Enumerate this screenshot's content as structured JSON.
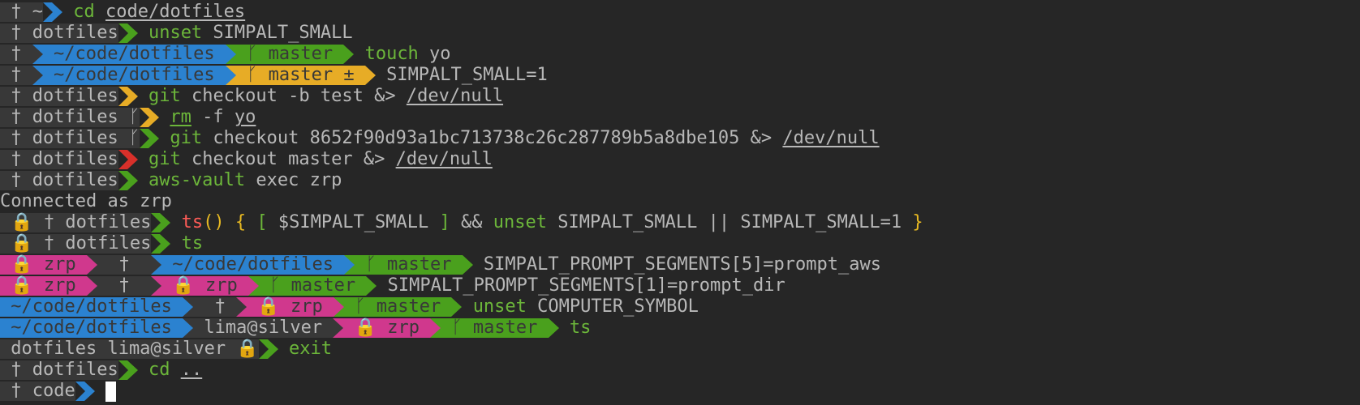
{
  "colors": {
    "bg": "#262626",
    "blue": "#2b82d0",
    "green": "#4aa01d",
    "yellow": "#e7ac26",
    "red": "#d8302a",
    "magenta": "#d0388d",
    "dark": "#383838",
    "text": "#b8b8b8",
    "cmd_green": "#6cb63a",
    "cmd_red": "#ff5c57",
    "cmd_yellow": "#e6b822",
    "cmd_blue": "#3c8bd1"
  },
  "lines": [
    {
      "segs": [
        {
          "t": " † ~",
          "bg": "dark",
          "fg": "text"
        },
        {
          "t": " ",
          "bg": "blue",
          "fg": "dark",
          "arrowOnly": true
        }
      ],
      "cmd": [
        {
          "t": " "
        },
        {
          "t": "cd",
          "c": "cmd_green"
        },
        {
          "t": " "
        },
        {
          "t": "code/dotfiles",
          "u": true
        }
      ]
    },
    {
      "segs": [
        {
          "t": " † dotfiles",
          "bg": "dark",
          "fg": "text"
        },
        {
          "t": "",
          "bg": "green",
          "arrowOnly": true
        }
      ],
      "cmd": [
        {
          "t": " "
        },
        {
          "t": "unset",
          "c": "cmd_green"
        },
        {
          "t": " SIMPALT_SMALL"
        }
      ]
    },
    {
      "segs": [
        {
          "t": " † ",
          "bg": "dark",
          "fg": "text"
        },
        {
          "t": " ~/code/dotfiles ",
          "bg": "blue",
          "fg": "dark"
        },
        {
          "t": " ᚴ master ",
          "bg": "green",
          "fg": "dark"
        }
      ],
      "cmd": [
        {
          "t": " "
        },
        {
          "t": "touch",
          "c": "cmd_green"
        },
        {
          "t": " yo"
        }
      ]
    },
    {
      "segs": [
        {
          "t": " † ",
          "bg": "dark",
          "fg": "text"
        },
        {
          "t": " ~/code/dotfiles ",
          "bg": "blue",
          "fg": "dark"
        },
        {
          "t": " ᚴ master ± ",
          "bg": "yellow",
          "fg": "dark"
        }
      ],
      "cmd": [
        {
          "t": " SIMPALT_SMALL=1"
        }
      ]
    },
    {
      "segs": [
        {
          "t": " † dotfiles",
          "bg": "dark",
          "fg": "text"
        },
        {
          "t": "",
          "bg": "yellow",
          "arrowOnly": true
        }
      ],
      "cmd": [
        {
          "t": " "
        },
        {
          "t": "git",
          "c": "cmd_green"
        },
        {
          "t": " checkout -b test &> "
        },
        {
          "t": "/dev/null",
          "u": true
        }
      ]
    },
    {
      "segs": [
        {
          "t": " † dotfiles ",
          "bg": "dark",
          "fg": "text"
        },
        {
          "t": "ᚴ",
          "bg": "dark",
          "fg": "text",
          "branch": true
        },
        {
          "t": "",
          "bg": "yellow",
          "arrowOnly": true
        }
      ],
      "cmd": [
        {
          "t": " "
        },
        {
          "t": "rm",
          "c": "cmd_green",
          "u": true
        },
        {
          "t": " -f "
        },
        {
          "t": "yo",
          "u": true
        }
      ]
    },
    {
      "segs": [
        {
          "t": " † dotfiles ",
          "bg": "dark",
          "fg": "text"
        },
        {
          "t": "ᚴ",
          "bg": "dark",
          "fg": "text",
          "branch": true
        },
        {
          "t": "",
          "bg": "green",
          "arrowOnly": true
        }
      ],
      "cmd": [
        {
          "t": " "
        },
        {
          "t": "git",
          "c": "cmd_green"
        },
        {
          "t": " checkout 8652f90d93a1bc713738c26c287789b5a8dbe105 &> "
        },
        {
          "t": "/dev/null",
          "u": true
        }
      ]
    },
    {
      "segs": [
        {
          "t": " † dotfiles",
          "bg": "dark",
          "fg": "text"
        },
        {
          "t": "",
          "bg": "red",
          "arrowOnly": true
        }
      ],
      "cmd": [
        {
          "t": " "
        },
        {
          "t": "git",
          "c": "cmd_green"
        },
        {
          "t": " checkout master &> "
        },
        {
          "t": "/dev/null",
          "u": true
        }
      ]
    },
    {
      "segs": [
        {
          "t": " † dotfiles",
          "bg": "dark",
          "fg": "text"
        },
        {
          "t": "",
          "bg": "green",
          "arrowOnly": true
        }
      ],
      "cmd": [
        {
          "t": " "
        },
        {
          "t": "aws-vault",
          "c": "cmd_green"
        },
        {
          "t": " exec zrp"
        }
      ]
    },
    {
      "plain": "Connected as zrp"
    },
    {
      "segs": [
        {
          "t": " 🔒 † dotfiles",
          "bg": "dark",
          "fg": "text",
          "lock": true
        },
        {
          "t": "",
          "bg": "green",
          "arrowOnly": true
        }
      ],
      "cmd": [
        {
          "t": " "
        },
        {
          "t": "ts",
          "c": "cmd_red"
        },
        {
          "t": "()",
          "c": "cmd_yellow"
        },
        {
          "t": " "
        },
        {
          "t": "{",
          "c": "cmd_yellow"
        },
        {
          "t": " "
        },
        {
          "t": "[",
          "c": "cmd_green"
        },
        {
          "t": " $SIMPALT_SMALL "
        },
        {
          "t": "]",
          "c": "cmd_green"
        },
        {
          "t": " && "
        },
        {
          "t": "unset",
          "c": "cmd_green"
        },
        {
          "t": " SIMPALT_SMALL || SIMPALT_SMALL=1 "
        },
        {
          "t": "}",
          "c": "cmd_yellow"
        }
      ]
    },
    {
      "segs": [
        {
          "t": " 🔒 † dotfiles",
          "bg": "dark",
          "fg": "text",
          "lock": true
        },
        {
          "t": "",
          "bg": "green",
          "arrowOnly": true
        }
      ],
      "cmd": [
        {
          "t": " "
        },
        {
          "t": "ts",
          "c": "cmd_green"
        }
      ]
    },
    {
      "segs": [
        {
          "t": " 🔒 zrp ",
          "bg": "magenta",
          "fg": "dark",
          "lock": true
        },
        {
          "t": "  †  ",
          "bg": "dark",
          "fg": "text"
        },
        {
          "t": " ~/code/dotfiles ",
          "bg": "blue",
          "fg": "dark"
        },
        {
          "t": " ᚴ master ",
          "bg": "green",
          "fg": "dark"
        }
      ],
      "cmd": [
        {
          "t": " SIMPALT_PROMPT_SEGMENTS[5]=prompt_aws"
        }
      ]
    },
    {
      "segs": [
        {
          "t": " 🔒 zrp ",
          "bg": "magenta",
          "fg": "dark",
          "lock": true
        },
        {
          "t": "  †  ",
          "bg": "dark",
          "fg": "text"
        },
        {
          "t": " 🔒 zrp ",
          "bg": "magenta",
          "fg": "dark",
          "lock": true
        },
        {
          "t": " ᚴ master ",
          "bg": "green",
          "fg": "dark"
        }
      ],
      "cmd": [
        {
          "t": " SIMPALT_PROMPT_SEGMENTS[1]=prompt_dir"
        }
      ]
    },
    {
      "segs": [
        {
          "t": " ~/code/dotfiles ",
          "bg": "blue",
          "fg": "dark"
        },
        {
          "t": "  † ",
          "bg": "dark",
          "fg": "text"
        },
        {
          "t": " 🔒 zrp ",
          "bg": "magenta",
          "fg": "dark",
          "lock": true
        },
        {
          "t": " ᚴ master ",
          "bg": "green",
          "fg": "dark"
        }
      ],
      "cmd": [
        {
          "t": " "
        },
        {
          "t": "unset",
          "c": "cmd_green"
        },
        {
          "t": " COMPUTER_SYMBOL"
        }
      ]
    },
    {
      "segs": [
        {
          "t": " ~/code/dotfiles ",
          "bg": "blue",
          "fg": "dark"
        },
        {
          "t": " lima@silver ",
          "bg": "dark",
          "fg": "text"
        },
        {
          "t": " 🔒 zrp ",
          "bg": "magenta",
          "fg": "dark",
          "lock": true
        },
        {
          "t": " ᚴ master ",
          "bg": "green",
          "fg": "dark"
        }
      ],
      "cmd": [
        {
          "t": " "
        },
        {
          "t": "ts",
          "c": "cmd_green"
        }
      ]
    },
    {
      "segs": [
        {
          "t": " dotfiles lima@silver 🔒",
          "bg": "dark",
          "fg": "text",
          "lock": true
        },
        {
          "t": "",
          "bg": "green",
          "arrowOnly": true
        }
      ],
      "cmd": [
        {
          "t": " "
        },
        {
          "t": "exit",
          "c": "cmd_green"
        }
      ]
    },
    {
      "segs": [
        {
          "t": " † dotfiles",
          "bg": "dark",
          "fg": "text"
        },
        {
          "t": "",
          "bg": "green",
          "arrowOnly": true
        }
      ],
      "cmd": [
        {
          "t": " "
        },
        {
          "t": "cd",
          "c": "cmd_green"
        },
        {
          "t": " "
        },
        {
          "t": "..",
          "u": true
        }
      ]
    },
    {
      "segs": [
        {
          "t": " † code",
          "bg": "dark",
          "fg": "text"
        },
        {
          "t": "",
          "bg": "blue",
          "arrowOnly": true
        }
      ],
      "cmd": [
        {
          "t": " "
        }
      ],
      "cursor": true
    }
  ]
}
